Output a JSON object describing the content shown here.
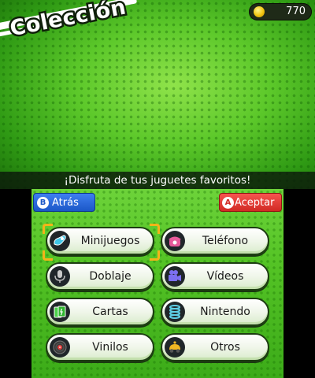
{
  "top_screen": {
    "title": "Colección",
    "coins": "770",
    "message": "¡Disfruta de tus juguetes favoritos!"
  },
  "bottom_screen": {
    "back_button": {
      "glyph": "B",
      "label": "Atrás",
      "color": "#1b57c7"
    },
    "accept_button": {
      "glyph": "A",
      "label": "Aceptar",
      "color": "#d12a24"
    },
    "menu": [
      {
        "label": "Minijuegos",
        "icon": "minigames-icon",
        "selected": true
      },
      {
        "label": "Teléfono",
        "icon": "telephone-icon"
      },
      {
        "label": "Doblaje",
        "icon": "microphone-icon"
      },
      {
        "label": "Vídeos",
        "icon": "video-camera-icon"
      },
      {
        "label": "Cartas",
        "icon": "cards-icon"
      },
      {
        "label": "Nintendo",
        "icon": "nintendo-spring-icon"
      },
      {
        "label": "Vinilos",
        "icon": "vinyl-record-icon"
      },
      {
        "label": "Otros",
        "icon": "toy-car-icon"
      }
    ]
  },
  "colors": {
    "background_green": "#54c325",
    "selection_highlight": "#f3b418",
    "coin": "#f1c40f"
  }
}
